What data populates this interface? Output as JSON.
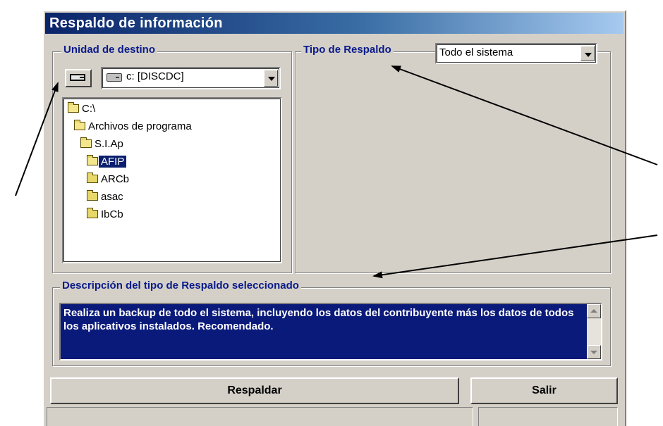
{
  "window": {
    "title": "Respaldo de información"
  },
  "destination": {
    "group_label": "Unidad de destino",
    "drive_value": "c: [DISCDC]",
    "tree": [
      {
        "label": "C:\\",
        "level": 0,
        "open": true,
        "selected": false
      },
      {
        "label": "Archivos de programa",
        "level": 1,
        "open": true,
        "selected": false
      },
      {
        "label": "S.I.Ap",
        "level": 2,
        "open": true,
        "selected": false
      },
      {
        "label": "AFIP",
        "level": 3,
        "open": true,
        "selected": true
      },
      {
        "label": "ARCb",
        "level": 3,
        "open": false,
        "selected": false
      },
      {
        "label": "asac",
        "level": 3,
        "open": false,
        "selected": false
      },
      {
        "label": "IbCb",
        "level": 3,
        "open": false,
        "selected": false
      }
    ]
  },
  "backup_type": {
    "group_label": "Tipo de Respaldo",
    "selected": "Todo el sistema"
  },
  "description": {
    "group_label": "Descripción del tipo de Respaldo seleccionado",
    "text": "Realiza un backup de todo el sistema, incluyendo los datos del contribuyente más los datos de todos los aplicativos instalados. Recomendado."
  },
  "buttons": {
    "backup": "Respaldar",
    "exit": "Salir"
  },
  "colors": {
    "title_start": "#0a246a",
    "selection": "#0a1f6e",
    "group_label": "#0a1a8a",
    "description_bg": "#0a1a7a"
  }
}
